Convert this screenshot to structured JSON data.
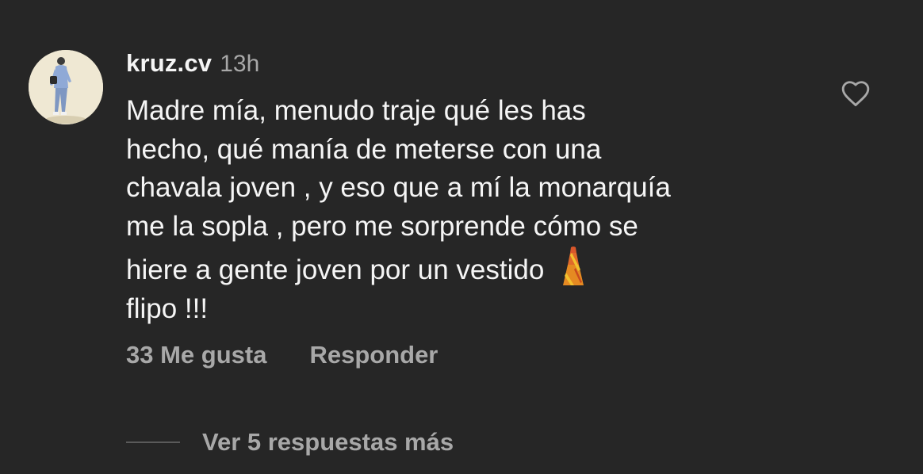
{
  "comment": {
    "username": "kruz.cv",
    "timestamp": "13h",
    "lines": [
      "Madre mía, menudo traje qué les has",
      "hecho, qué manía de meterse con una",
      "chavala joven , y eso que a mí la monarquía",
      "me la sopla , pero me sorprende cómo se",
      "hiere a gente joven por un vestido",
      "flipo !!!"
    ],
    "emoji": "dress-emoji",
    "likes_label": "33 Me gusta",
    "reply_label": "Responder",
    "view_replies_label": "Ver 5 respuestas más"
  },
  "icons": {
    "like": "heart-outline-icon",
    "avatar": "avatar-photo"
  },
  "colors": {
    "background": "#262626",
    "primary_text": "#f5f5f5",
    "secondary_text": "#a8a8a8",
    "avatar_bg": "#efe8d3"
  }
}
